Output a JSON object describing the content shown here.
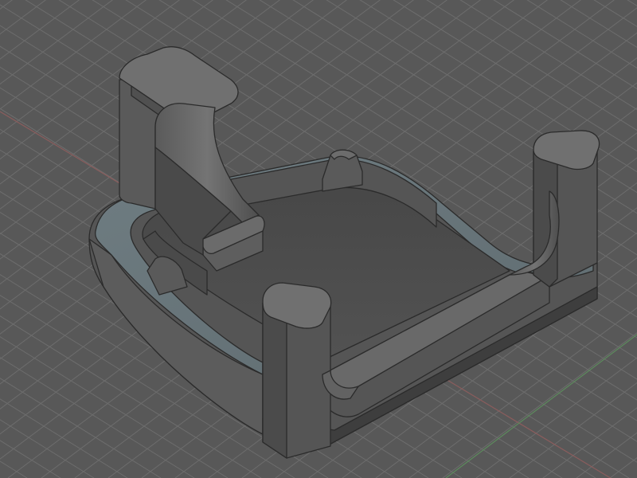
{
  "scene": {
    "background_color": "#585858",
    "grid_color": "#6d6d6d",
    "axis_red_color": "#8a5d5d",
    "axis_green_color": "#5d8a5d",
    "model_colors": {
      "top": "#707070",
      "side_light": "#5e5e5e",
      "side_dark": "#474747",
      "floor": "#4c4c4c",
      "rim_highlight": "#6f7d82",
      "edge": "#2b2b2b"
    }
  }
}
